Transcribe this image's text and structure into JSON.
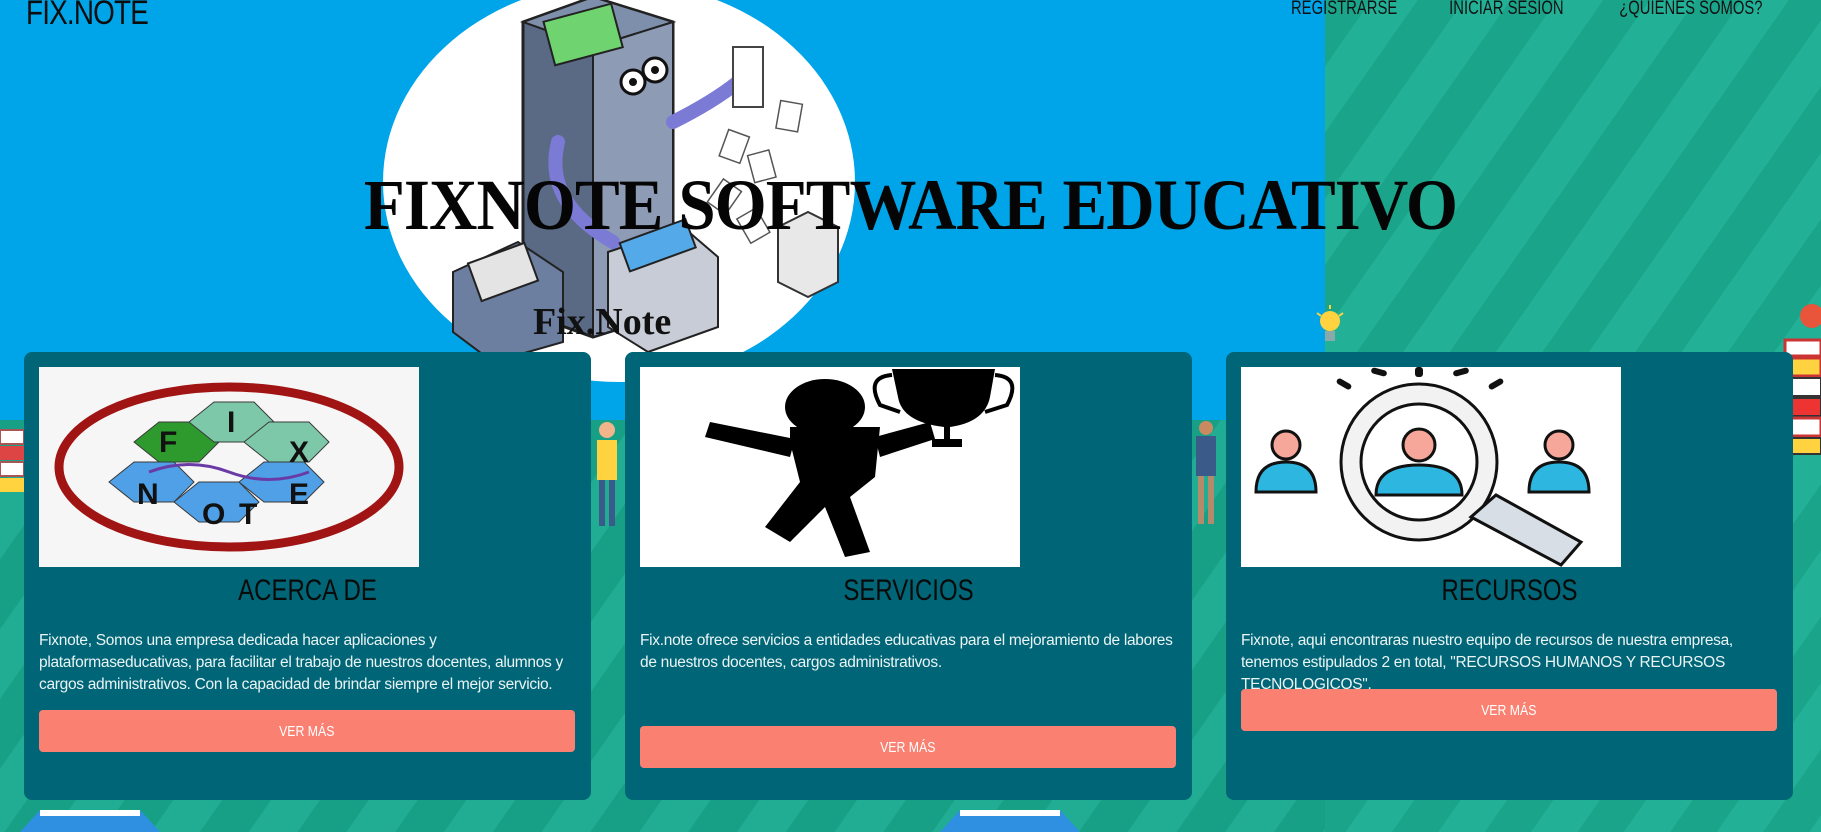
{
  "header": {
    "brand": "FIX.NOTE",
    "nav": [
      {
        "label": "REGISTRARSE"
      },
      {
        "label": "INICIAR SESION"
      },
      {
        "label": "¿QUIENES SOMOS?"
      }
    ]
  },
  "hero": {
    "title": "FIXNOTE SOFTWARE EDUCATIVO",
    "image_caption": "Fix.Note"
  },
  "cards": [
    {
      "title": "ACERCA DE",
      "text": "Fixnote, Somos una empresa dedicada hacer aplicaciones y plataformaseducativas, para facilitar el trabajo de nuestros docentes, alumnos y cargos administrativos. Con la capacidad de brindar siempre el mejor servicio.",
      "button": "VER MÁS",
      "logo_letters": [
        "F",
        "I",
        "X",
        "N",
        "O",
        "T",
        "E"
      ]
    },
    {
      "title": "SERVICIOS",
      "text": "Fix.note ofrece servicios a entidades educativas para el mejoramiento de labores de nuestros docentes, cargos administrativos.",
      "button": "VER MÁS"
    },
    {
      "title": "RECURSOS",
      "text": "Fixnote, aqui encontraras nuestro equipo de recursos de nuestra empresa, tenemos estipulados 2 en total, \"RECURSOS HUMANOS Y RECURSOS TECNOLOGICOS\".",
      "button": "VER MÁS"
    }
  ],
  "colors": {
    "hero_blue": "#00a4e8",
    "teal_bg": "#1a9d86",
    "card_bg": "#006677",
    "button": "#fa8072"
  }
}
